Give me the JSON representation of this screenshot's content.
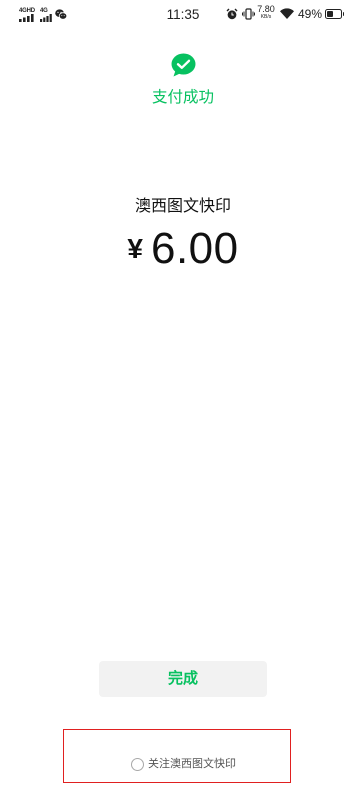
{
  "status_bar": {
    "sim1_network": "4GHD",
    "sim2_network": "4G",
    "time": "11:35",
    "net_speed": "7.80",
    "net_speed_unit": "KB/s",
    "battery_text": "49%",
    "battery_level": 0.49,
    "icons": [
      "signal-bars-icon",
      "signal-bars-icon",
      "wechat-icon",
      "alarm-icon",
      "vibrate-icon",
      "wifi-icon",
      "battery-icon"
    ]
  },
  "payment_result": {
    "status_icon": "success-check-icon",
    "title": "支付成功",
    "merchant_name": "澳西图文快印",
    "currency_symbol": "¥",
    "amount": "6.00"
  },
  "done_button": {
    "label": "完成"
  },
  "follow_merchant": {
    "label": "关注澳西图文快印",
    "checked": false
  },
  "colors": {
    "accent": "#07c160",
    "text_primary": "#111111",
    "button_background": "#f2f2f2",
    "highlight_border": "#e02020",
    "secondary_text": "#555555"
  }
}
